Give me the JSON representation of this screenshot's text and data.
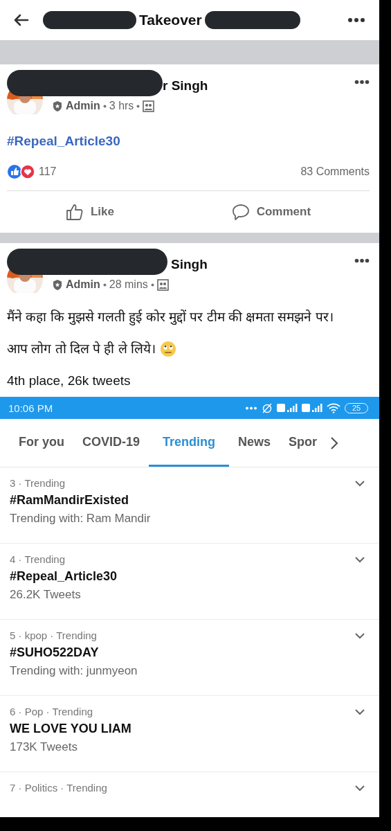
{
  "header": {
    "title": "Takeover"
  },
  "posts": [
    {
      "author": "r Singh",
      "role": "Admin",
      "time": "3 hrs",
      "paragraphs": [
        {
          "kind": "hashtag",
          "text": "#Repeal_Article30",
          "emoji": false
        }
      ],
      "reactions": "117",
      "comments": "83 Comments",
      "actions": [
        "Like",
        "Comment"
      ]
    },
    {
      "author": "Singh",
      "role": "Admin",
      "time": "28 mins",
      "paragraphs": [
        {
          "kind": "text",
          "text": "मैंने कहा कि मुझसे गलती हुई कोर मुद्दों पर टीम की क्षमता समझने पर।",
          "emoji": false
        },
        {
          "kind": "text",
          "text": "आप लोग तो दिल पे ही ले लिये।",
          "emoji": true
        },
        {
          "kind": "text",
          "text": "4th place, 26k tweets",
          "emoji": false
        }
      ]
    }
  ],
  "embedded_screenshot": {
    "status_bar": {
      "time": "10:06 PM",
      "battery": "25"
    },
    "tabs": [
      {
        "label": "For you",
        "selected": false
      },
      {
        "label": "COVID-19",
        "selected": false
      },
      {
        "label": "Trending",
        "selected": true
      },
      {
        "label": "News",
        "selected": false
      },
      {
        "label": "Spor",
        "selected": false
      }
    ],
    "trends": [
      {
        "meta": "3 · Trending",
        "title": "#RamMandirExisted",
        "detail": "Trending with: Ram Mandir"
      },
      {
        "meta": "4 · Trending",
        "title": "#Repeal_Article30",
        "detail": "26.2K Tweets"
      },
      {
        "meta": "5 · kpop · Trending",
        "title": "#SUHO522DAY",
        "detail": "Trending with: junmyeon"
      },
      {
        "meta": "6 · Pop · Trending",
        "title": "WE LOVE YOU LIAM",
        "detail": "173K Tweets"
      },
      {
        "meta": "7 · Politics · Trending"
      }
    ]
  }
}
